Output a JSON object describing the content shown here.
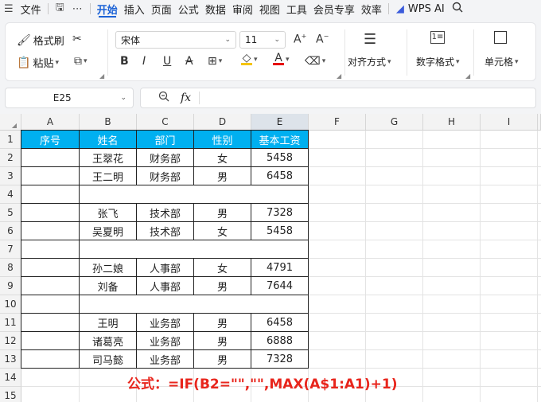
{
  "menu": {
    "file": "文件",
    "tabs": [
      "开始",
      "插入",
      "页面",
      "公式",
      "数据",
      "审阅",
      "视图",
      "工具",
      "会员专享",
      "效率"
    ],
    "active_tab": "开始",
    "wps_ai": "WPS AI"
  },
  "ribbon": {
    "format_painter": "格式刷",
    "paste": "粘贴",
    "font_name": "宋体",
    "font_size": "11",
    "align_label": "对齐方式",
    "number_format_label": "数字格式",
    "cell_label": "单元格",
    "bold": "B",
    "italic": "I",
    "underline": "U",
    "strike": "A",
    "font_color_glyph": "A",
    "font_color": "#e60000",
    "fill_color": "#f5c400"
  },
  "formula_bar": {
    "name_box": "E25",
    "fx": "fx",
    "value": ""
  },
  "sheet": {
    "columns": [
      "A",
      "B",
      "C",
      "D",
      "E",
      "F",
      "G",
      "H",
      "I"
    ],
    "selected_column": "E",
    "rows": [
      "1",
      "2",
      "3",
      "4",
      "5",
      "6",
      "7",
      "8",
      "9",
      "10",
      "11",
      "12",
      "13",
      "14",
      "15"
    ],
    "header_fill": "#00b0f0",
    "table": {
      "headers": [
        "序号",
        "姓名",
        "部门",
        "性别",
        "基本工资"
      ],
      "rows": [
        [
          "",
          "王翠花",
          "财务部",
          "女",
          "5458"
        ],
        [
          "",
          "王二明",
          "财务部",
          "男",
          "6458"
        ],
        null,
        [
          "",
          "张飞",
          "技术部",
          "男",
          "7328"
        ],
        [
          "",
          "吴夏明",
          "技术部",
          "女",
          "5458"
        ],
        null,
        [
          "",
          "孙二娘",
          "人事部",
          "女",
          "4791"
        ],
        [
          "",
          "刘备",
          "人事部",
          "男",
          "7644"
        ],
        null,
        [
          "",
          "王明",
          "业务部",
          "男",
          "6458"
        ],
        [
          "",
          "诸葛亮",
          "业务部",
          "男",
          "6888"
        ],
        [
          "",
          "司马懿",
          "业务部",
          "男",
          "7328"
        ]
      ]
    },
    "annotation": "公式：=IF(B2=\"\",\"\",MAX(A$1:A1)+1)",
    "annotation_color": "#e8251c"
  }
}
